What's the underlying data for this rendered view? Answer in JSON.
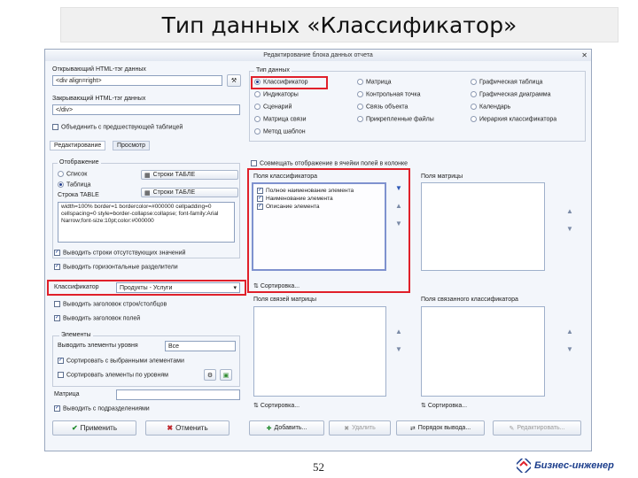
{
  "slide": {
    "title": "Тип данных «Классификатор»",
    "page_number": "52"
  },
  "brand": {
    "name": "Бизнес-инженер"
  },
  "dialog": {
    "title": "Редактирование блока данных отчета",
    "close": "✕",
    "left": {
      "source_label": "Открывающий HTML-тэг данных",
      "source_value": "<div align=right>",
      "close_label": "Закрывающий HTML-тэг данных",
      "close_value": "</div>",
      "combine_label": "Объединить с предшествующей таблицей",
      "tabs": [
        "Редактирование",
        "Просмотр"
      ],
      "display_group": "Отображение",
      "display_list": "Список",
      "display_table": "Таблица",
      "row_label": "Строки ТАБЛЕ",
      "row_btn1": "Строки ТАБЛЕ",
      "row_btn2": "Строки ТАБЛЕ",
      "table_tag_label": "Строка TABLE",
      "code": "width=100% border=1 bordercolor=#000000 cellpadding=0 cellspacing=0 style=border-collapse:collapse; font-family:Arial Narrow;font-size:10pt;color:#000000",
      "chk1": "Выводить строки отсутствующих значений",
      "chk2": "Выводить горизонтальные разделители",
      "classifier_label": "Классификатор",
      "classifier_value": "Продукты - Услуги",
      "chk3": "Выводить заголовок строк/столбцов",
      "chk4": "Выводить заголовок полей",
      "elements_group": "Элементы",
      "level_label": "Выводить элементы уровня",
      "level_value": "Все",
      "chk5": "Сортировать с выбранными элементами",
      "chk6": "Сортировать элементы по уровням",
      "matrix_label": "Матрица",
      "chk7": "Выводить с подразделениями"
    },
    "right": {
      "type_group": "Тип данных",
      "types": [
        [
          "Классификатор",
          "Матрица",
          "Графическая таблица"
        ],
        [
          "Индикаторы",
          "Контрольная точка",
          "Графическая диаграмма"
        ],
        [
          "Сценарий",
          "Связь объекта",
          "Календарь"
        ],
        [
          "Матрица связи",
          "Прикрепленные файлы",
          "Иерархия классификатора"
        ],
        [
          "Метод шаблон",
          "",
          ""
        ]
      ],
      "split_label": "Совмещать отображение в ячейки полей в колонке",
      "fields_label": "Поля классификатора",
      "fields": [
        "Полное наименование элемента",
        "Наименование элемента",
        "Описание элемента"
      ],
      "matrix_fields": "Поля матрицы",
      "sort_label": "Сортировка...",
      "link_fields": "Поля связей матрицы",
      "linked_cls": "Поля связанного классификатора",
      "sort2": "Сортировка...",
      "sort3": "Сортировка...",
      "btn_add": "Добавить...",
      "btn_del": "Удалить",
      "btn_order": "Порядок вывода...",
      "btn_edit": "Редактировать..."
    },
    "buttons": {
      "apply": "Применить",
      "cancel": "Отменить"
    }
  },
  "colors": {
    "highlight": "#e0202a",
    "accent": "#1c3e8c"
  }
}
